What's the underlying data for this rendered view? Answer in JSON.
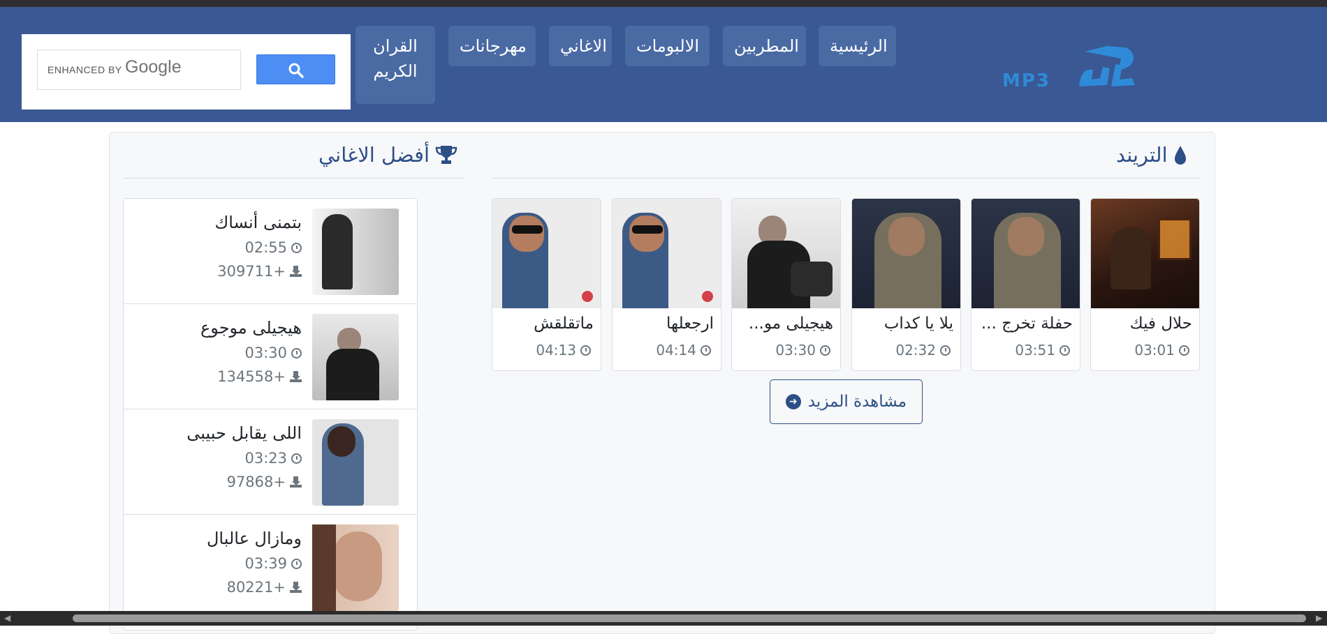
{
  "nav": {
    "items": [
      "الرئيسية",
      "المطربين",
      "الالبومات",
      "الاغاني",
      "مهرجانات",
      "القران الكريم"
    ]
  },
  "search": {
    "enhanced_label": "ENHANCED BY",
    "google_label": "Google"
  },
  "trend": {
    "heading": "التريند",
    "cards": [
      {
        "title": "حلال فيك",
        "duration": "03:01"
      },
      {
        "title": "حفلة تخرج ...",
        "duration": "03:51"
      },
      {
        "title": "يلا يا كداب",
        "duration": "02:32"
      },
      {
        "title": "هيجيلى مو...",
        "duration": "03:30"
      },
      {
        "title": "ارجعلها",
        "duration": "04:14"
      },
      {
        "title": "ماتقلقش",
        "duration": "04:13"
      }
    ],
    "more_label": "مشاهدة المزيد"
  },
  "top": {
    "heading": "أفضل الاغاني",
    "items": [
      {
        "title": "بتمنى أنساك",
        "duration": "02:55",
        "downloads": "+309711"
      },
      {
        "title": "هيجيلى موجوع",
        "duration": "03:30",
        "downloads": "+134558"
      },
      {
        "title": "اللى يقابل حبيبى",
        "duration": "03:23",
        "downloads": "+97868"
      },
      {
        "title": "ومازال عالبال",
        "duration": "03:39",
        "downloads": "+80221"
      }
    ]
  },
  "colors": {
    "header_bg": "#3a5893",
    "nav_bg": "#4a6aa3",
    "accent": "#2d4e86",
    "search_button": "#4d8ef4"
  }
}
